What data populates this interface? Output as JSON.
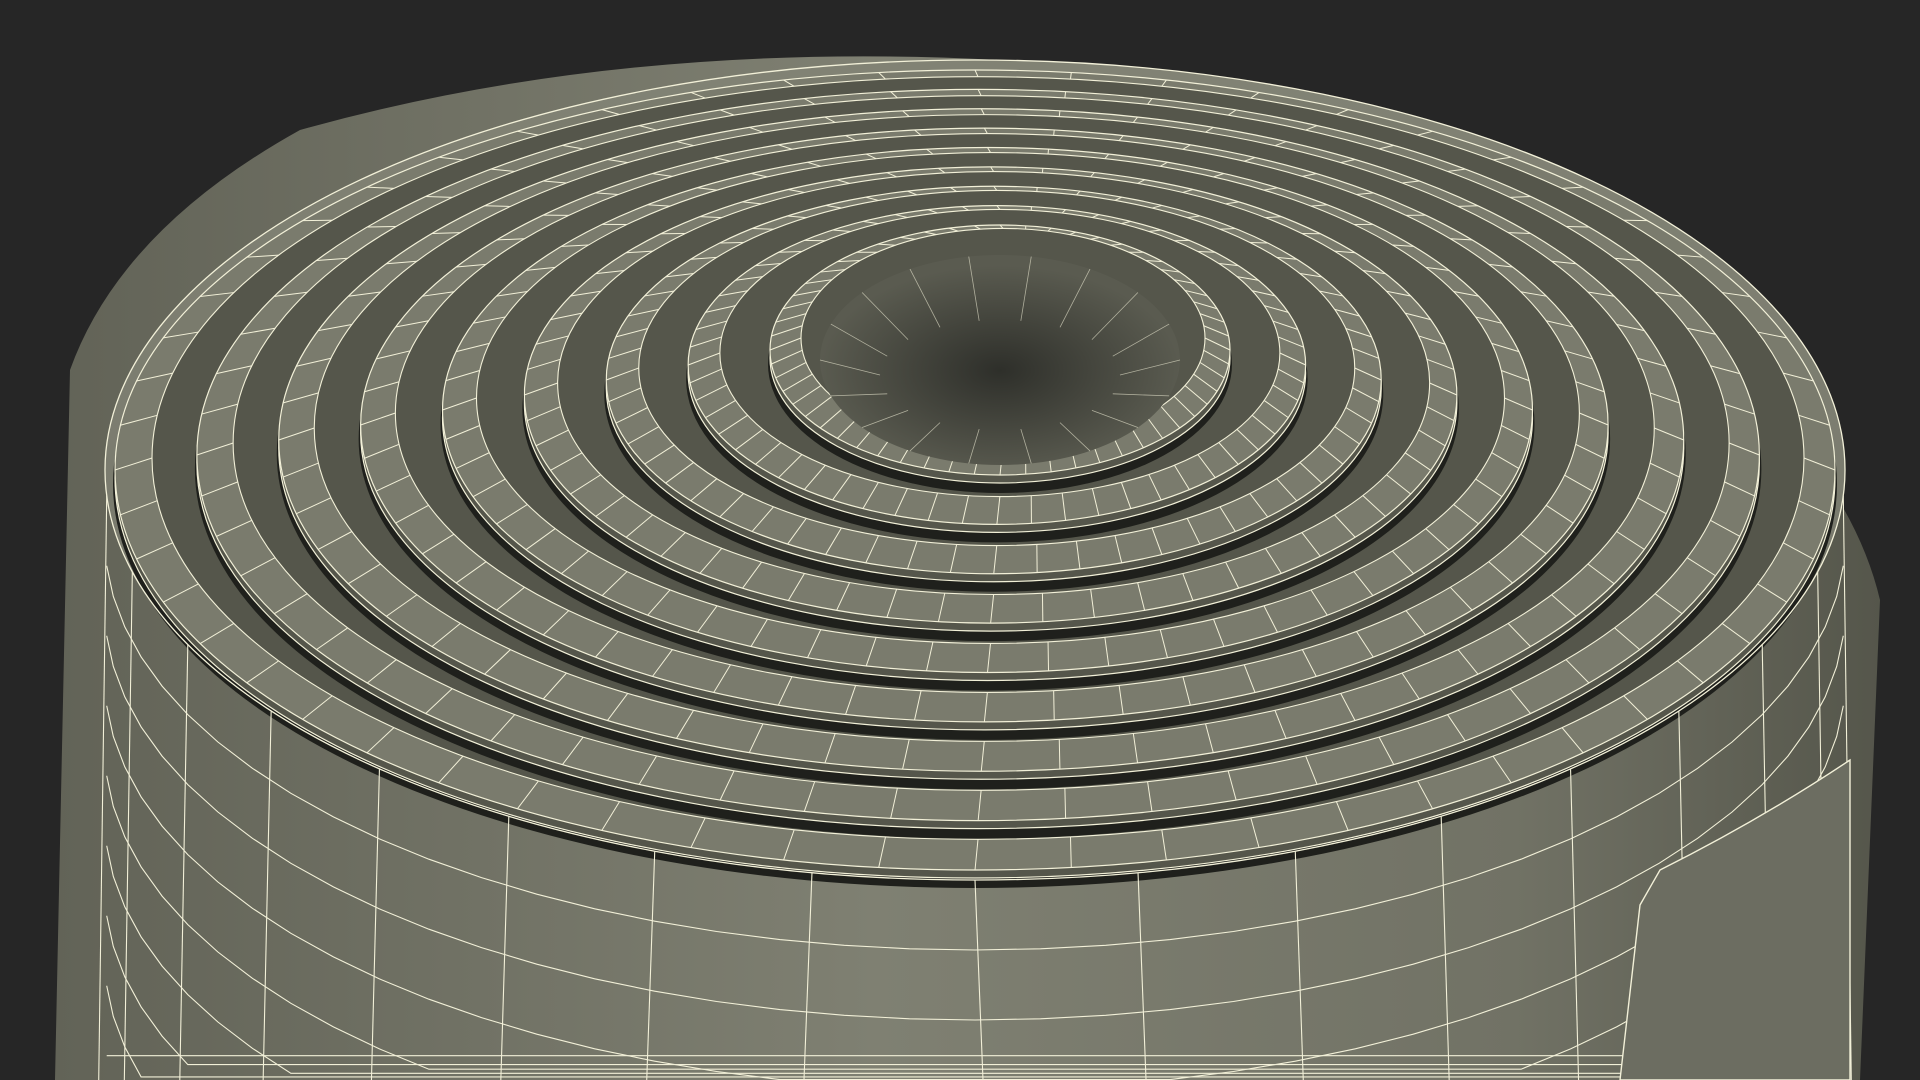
{
  "render": {
    "background_color": "#262626",
    "surface_color": "#7a7b6d",
    "surface_light_color": "#8a8b7c",
    "surface_dark_color": "#55564b",
    "gap_color": "#1f201c",
    "wire_color": "#f2f0d8",
    "core_color": "#4a4b42"
  }
}
